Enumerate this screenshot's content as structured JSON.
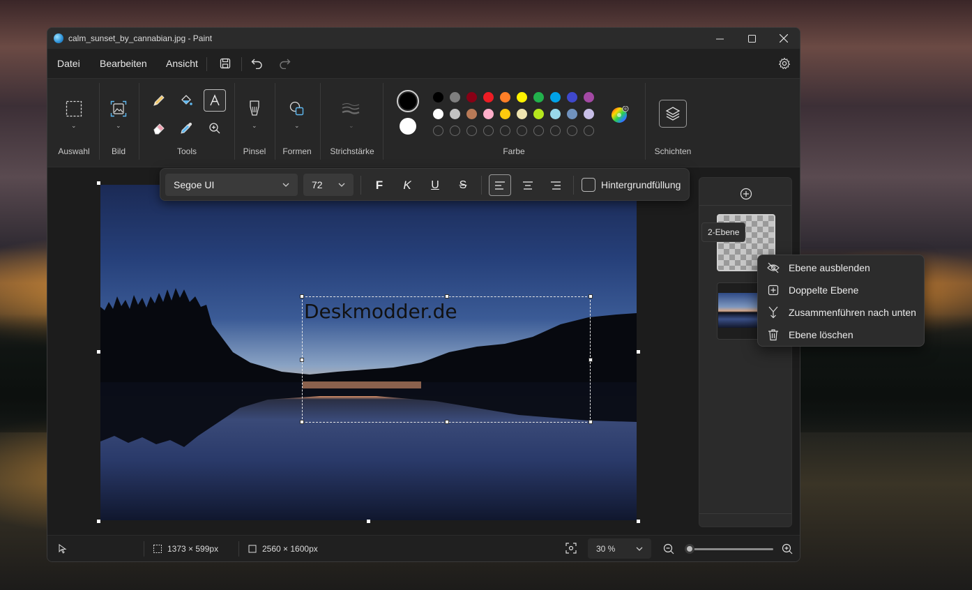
{
  "window": {
    "title": "calm_sunset_by_cannabian.jpg - Paint"
  },
  "menu": {
    "file": "Datei",
    "edit": "Bearbeiten",
    "view": "Ansicht"
  },
  "ribbon": {
    "selection": "Auswahl",
    "image": "Bild",
    "tools": "Tools",
    "brush": "Pinsel",
    "shapes": "Formen",
    "stroke": "Strichstärke",
    "color": "Farbe",
    "layers": "Schichten"
  },
  "palette": {
    "row1": [
      "#000000",
      "#7f7f7f",
      "#880015",
      "#ed1c24",
      "#ff7f27",
      "#fff200",
      "#22b14c",
      "#00a2e8",
      "#3f48cc",
      "#a349a4"
    ],
    "row2": [
      "#ffffff",
      "#c3c3c3",
      "#b97a57",
      "#ffaec9",
      "#ffc90e",
      "#efe4b0",
      "#b5e61d",
      "#99d9ea",
      "#7092be",
      "#c8bfe7"
    ]
  },
  "text_toolbar": {
    "font": "Segoe UI",
    "size": "72",
    "bold": "F",
    "italic": "K",
    "underline": "U",
    "strike": "S",
    "background_fill": "Hintergrundfüllung"
  },
  "canvas": {
    "text": "Deskmodder.de"
  },
  "layers_panel": {
    "tooltip": "2-Ebene"
  },
  "context_menu": {
    "hide": "Ebene ausblenden",
    "duplicate": "Doppelte Ebene",
    "merge_down": "Zusammenführen nach unten",
    "delete": "Ebene löschen"
  },
  "status": {
    "selection_size": "1373 × 599px",
    "canvas_size": "2560 × 1600px",
    "zoom": "30 %",
    "zoom_level": 0.03
  }
}
